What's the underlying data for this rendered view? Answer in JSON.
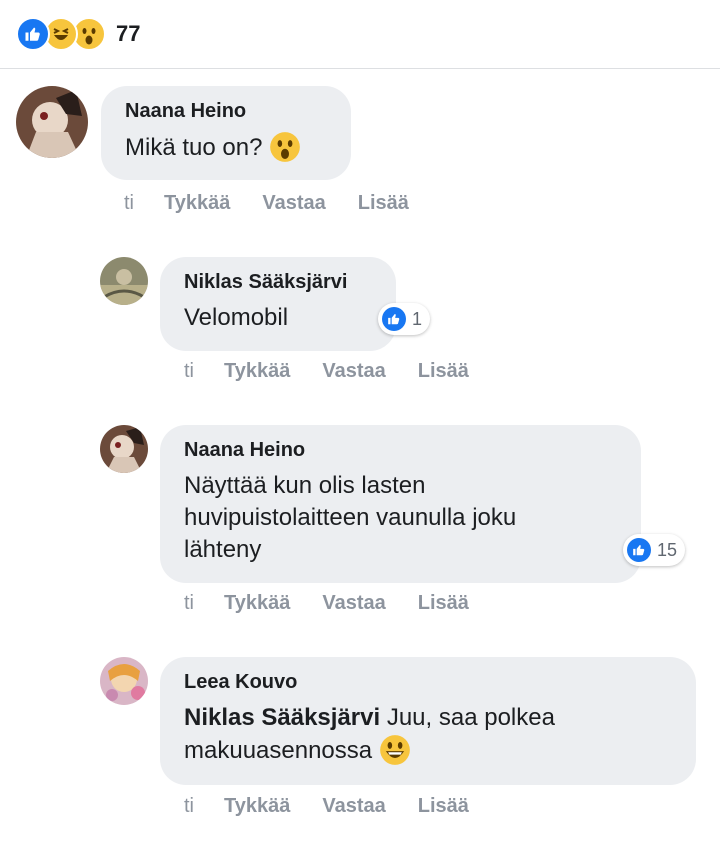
{
  "reactions": {
    "icons": [
      "like-icon",
      "haha-icon",
      "wow-icon"
    ],
    "count": "77"
  },
  "comments": [
    {
      "author": "Naana Heino",
      "text": "Mikä tuo on?",
      "emoji": "wow-emoji",
      "actions": {
        "time": "ti",
        "like": "Tykkää",
        "reply": "Vastaa",
        "more": "Lisää"
      }
    },
    {
      "author": "Niklas Sääksjärvi",
      "text": "Velomobil",
      "reaction_count": "1",
      "actions": {
        "time": "ti",
        "like": "Tykkää",
        "reply": "Vastaa",
        "more": "Lisää"
      }
    },
    {
      "author": "Naana Heino",
      "lines": [
        "Näyttää kun olis lasten",
        "huvipuistolaitteen vaunulla joku",
        "lähteny"
      ],
      "reaction_count": "15",
      "actions": {
        "time": "ti",
        "like": "Tykkää",
        "reply": "Vastaa",
        "more": "Lisää"
      }
    },
    {
      "author": "Leea Kouvo",
      "mention": "Niklas Sääksjärvi",
      "text_line1": "Juu, saa polkea",
      "text_line2": "makuuasennossa",
      "emoji": "grin-emoji",
      "actions": {
        "time": "ti",
        "like": "Tykkää",
        "reply": "Vastaa",
        "more": "Lisää"
      }
    }
  ],
  "colors": {
    "like_blue": "#1877f2",
    "bubble_bg": "#eceef1",
    "meta_gray": "#8d949e"
  }
}
